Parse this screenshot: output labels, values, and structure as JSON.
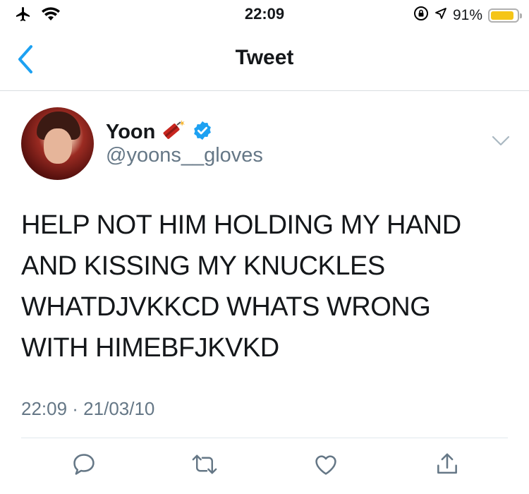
{
  "status_bar": {
    "time": "22:09",
    "battery_percent": "91%",
    "battery_level": 0.91,
    "icons": [
      "airplane-icon",
      "wifi-icon",
      "orientation-lock-icon",
      "location-icon",
      "battery-icon"
    ]
  },
  "nav": {
    "title": "Tweet",
    "back_icon": "chevron-left-icon"
  },
  "tweet": {
    "author_name": "Yoon",
    "author_emoji": "🧨",
    "verified": true,
    "handle": "@yoons__gloves",
    "text_lines": [
      "HELP NOT HIM HOLDING MY HAND",
      "AND KISSING MY KNUCKLES",
      "WHATDJVKKCD WHATS WRONG",
      "WITH HIMEBFJKVKD"
    ],
    "timestamp": "22:09 · 21/03/10"
  },
  "actions": [
    "reply-icon",
    "retweet-icon",
    "like-icon",
    "share-icon"
  ],
  "colors": {
    "accent": "#1da1f2",
    "secondary_text": "#657786",
    "battery": "#f5c518"
  }
}
